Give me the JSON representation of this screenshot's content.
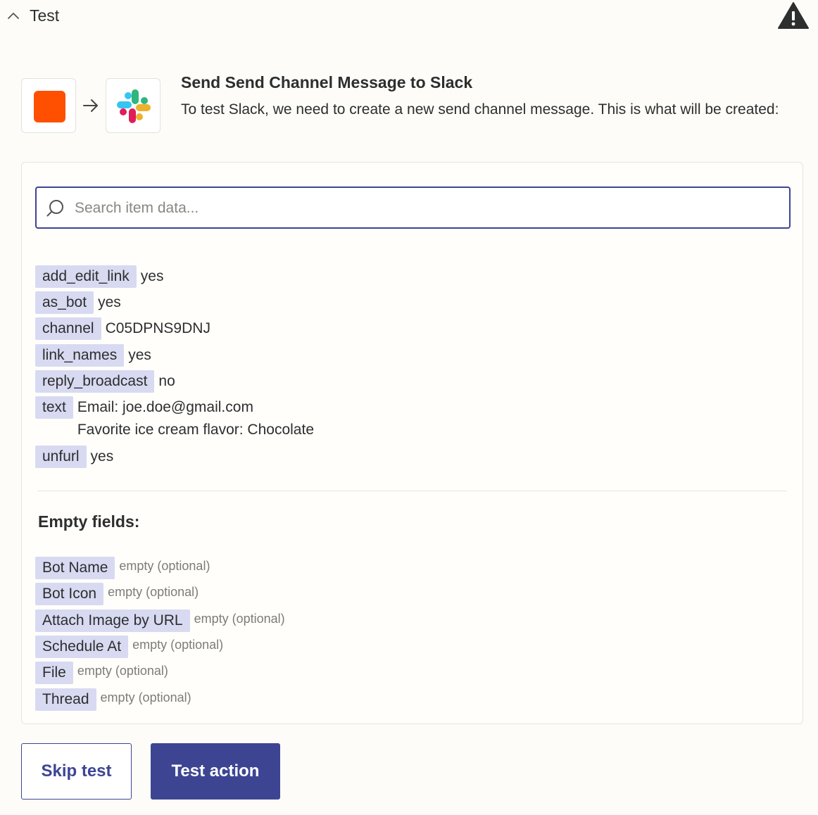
{
  "header": {
    "title": "Test"
  },
  "action": {
    "title": "Send Send Channel Message to Slack",
    "description": "To test Slack, we need to create a new send channel message. This is what will be created:"
  },
  "search": {
    "placeholder": "Search item data..."
  },
  "fields": [
    {
      "key": "add_edit_link",
      "value": "yes"
    },
    {
      "key": "as_bot",
      "value": "yes"
    },
    {
      "key": "channel",
      "value": "C05DPNS9DNJ"
    },
    {
      "key": "link_names",
      "value": "yes"
    },
    {
      "key": "reply_broadcast",
      "value": "no"
    },
    {
      "key": "text",
      "value": "Email: joe.doe@gmail.com\nFavorite ice cream flavor: Chocolate"
    },
    {
      "key": "unfurl",
      "value": "yes"
    }
  ],
  "empty_section": {
    "title": "Empty fields:",
    "items": [
      {
        "key": "Bot Name",
        "value": "empty (optional)"
      },
      {
        "key": "Bot Icon",
        "value": "empty (optional)"
      },
      {
        "key": "Attach Image by URL",
        "value": "empty (optional)"
      },
      {
        "key": "Schedule At",
        "value": "empty (optional)"
      },
      {
        "key": "File",
        "value": "empty (optional)"
      },
      {
        "key": "Thread",
        "value": "empty (optional)"
      }
    ]
  },
  "buttons": {
    "skip": "Skip test",
    "test": "Test action"
  },
  "icons": {
    "collapse": "chevron-up-icon",
    "warning": "warning-icon",
    "trigger_app": "orange-app-icon",
    "arrow": "arrow-right-icon",
    "action_app": "slack-icon",
    "search": "search-icon"
  },
  "colors": {
    "accent": "#3d4593",
    "key_chip": "#d8daf2",
    "trigger_orange": "#ff4f00",
    "background": "#fdfcf8"
  }
}
